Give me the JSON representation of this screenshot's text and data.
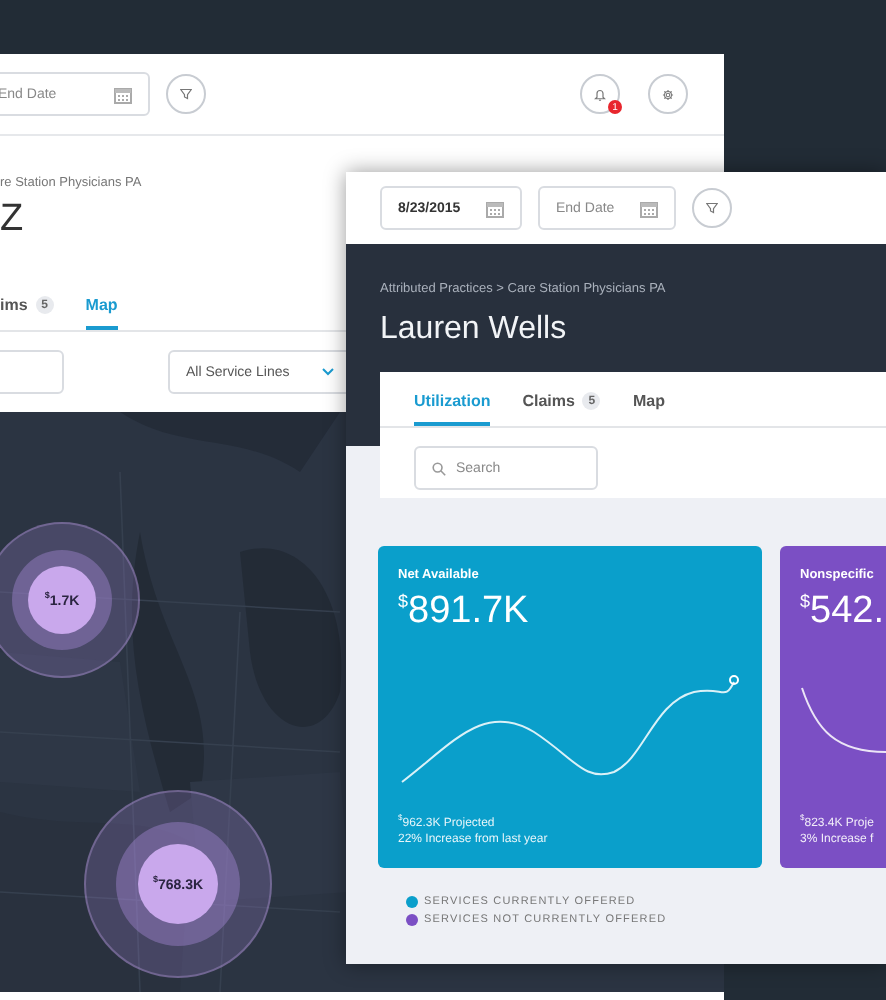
{
  "back_window": {
    "toolbar": {
      "end_date": {
        "placeholder": "End Date"
      },
      "notification_count": "1"
    },
    "breadcrumb": "re Station Physicians PA",
    "title": "Z",
    "tabs": [
      {
        "label": "ims",
        "count": "5",
        "selected": false
      },
      {
        "label": "Map",
        "selected": true
      }
    ],
    "service_filter": {
      "value": "All Service Lines"
    },
    "map": {
      "kind": "picture",
      "bubbles": [
        {
          "currency": "$",
          "value": "1.7K"
        },
        {
          "currency": "$",
          "value": "768.3K"
        }
      ]
    }
  },
  "front_window": {
    "toolbar": {
      "start_date": {
        "value": "8/23/2015"
      },
      "end_date": {
        "placeholder": "End Date"
      }
    },
    "breadcrumb": "Attributed Practices  >  Care Station Physicians PA",
    "title": "Lauren Wells",
    "tabs": [
      {
        "label": "Utilization",
        "selected": true
      },
      {
        "label": "Claims",
        "count": "5",
        "selected": false
      },
      {
        "label": "Map",
        "selected": false
      }
    ],
    "search": {
      "placeholder": "Search"
    },
    "cards": [
      {
        "title": "Net Available",
        "currency": "$",
        "amount": "891.7K",
        "projected": "962.3K Projected",
        "change": "22% Increase from last year",
        "color": "#0a9fcb"
      },
      {
        "title": "Nonspecific",
        "currency": "$",
        "amount": "542.",
        "projected": "823.4K Proje",
        "change": "3% Increase f",
        "color": "#7b4fc4"
      }
    ],
    "legend": [
      {
        "label": "SERVICES CURRENTLY OFFERED",
        "color": "#0a9fcb"
      },
      {
        "label": "SERVICES NOT CURRENTLY OFFERED",
        "color": "#7b4fc4"
      }
    ]
  }
}
